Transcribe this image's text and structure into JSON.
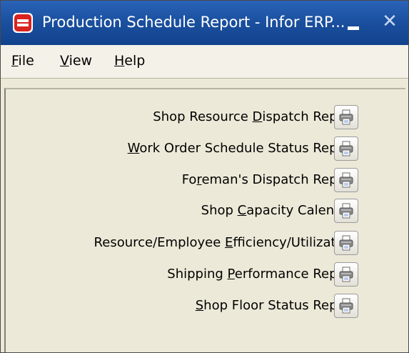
{
  "window": {
    "title": "Production Schedule Report - Infor ERP...",
    "close_glyph": "✕"
  },
  "menu": [
    {
      "label": "File",
      "accel": "F"
    },
    {
      "label": "View",
      "accel": "V"
    },
    {
      "label": "Help",
      "accel": "H"
    }
  ],
  "reports": [
    {
      "pre": "Shop Resource ",
      "accel": "D",
      "post": "ispatch Report"
    },
    {
      "pre": "",
      "accel": "W",
      "post": "ork Order Schedule Status Report"
    },
    {
      "pre": "Fo",
      "accel": "r",
      "post": "eman's Dispatch Report"
    },
    {
      "pre": "Shop ",
      "accel": "C",
      "post": "apacity Calendar"
    },
    {
      "pre": "Resource/Employee ",
      "accel": "E",
      "post": "fficiency/Utilization"
    },
    {
      "pre": "Shipping ",
      "accel": "P",
      "post": "erformance Report"
    },
    {
      "pre": "",
      "accel": "S",
      "post": "hop Floor Status Report"
    }
  ],
  "icons": {
    "app": "infor-erp-app-icon",
    "print": "printer-icon"
  },
  "colors": {
    "titlebar": "#1a4f9e",
    "window_bg": "#ece9d8",
    "menubar": "#f3f1e8"
  }
}
